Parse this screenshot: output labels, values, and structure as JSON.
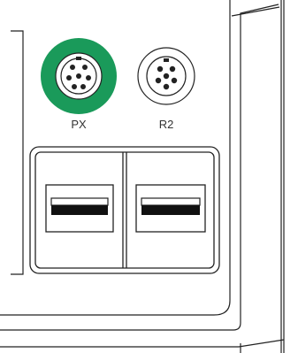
{
  "ports": {
    "px": {
      "label": "PX",
      "ring_color": "#1a9a5a",
      "icon": "round-pin-connector-icon"
    },
    "r2": {
      "label": "R2",
      "ring_color": "#ffffff",
      "icon": "round-pin-connector-icon"
    }
  },
  "usb_ports": [
    {
      "icon": "usb-a-port-icon"
    },
    {
      "icon": "usb-a-port-icon"
    }
  ]
}
